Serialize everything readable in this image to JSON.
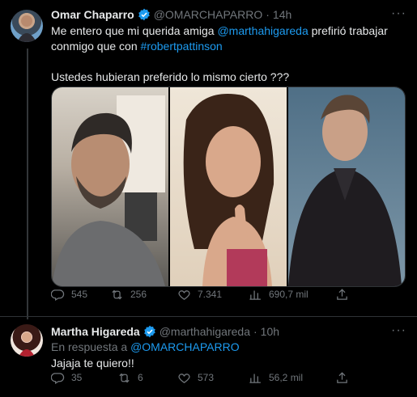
{
  "tweet1": {
    "name": "Omar Chaparro",
    "handle": "@OMARCHAPARRO",
    "time": "14h",
    "text_line1_a": "Me entero que mi querida amiga ",
    "mention1": "@marthahigareda",
    "text_line1_b": " prefirió trabajar",
    "text_line2_a": "conmigo que con ",
    "hashtag": "#robertpattinson",
    "text_line3": "Ustedes hubieran preferido lo mismo cierto ???",
    "replies": "545",
    "retweets": "256",
    "likes": "7.341",
    "views": "690,7 mil"
  },
  "tweet2": {
    "name": "Martha Higareda",
    "handle": "@marthahigareda",
    "time": "10h",
    "reply_prefix": "En respuesta a ",
    "reply_handle": "@OMARCHAPARRO",
    "text": "Jajaja te quiero!!",
    "replies": "35",
    "retweets": "6",
    "likes": "573",
    "views": "56,2 mil"
  },
  "icons": {
    "verified": "verified-badge-icon",
    "reply": "reply-icon",
    "retweet": "retweet-icon",
    "like": "heart-icon",
    "views": "views-icon",
    "share": "share-icon",
    "more": "more-icon"
  },
  "colors": {
    "accent": "#1d9bf0",
    "muted": "#71767b",
    "text": "#e7e9ea",
    "background": "#000000"
  }
}
